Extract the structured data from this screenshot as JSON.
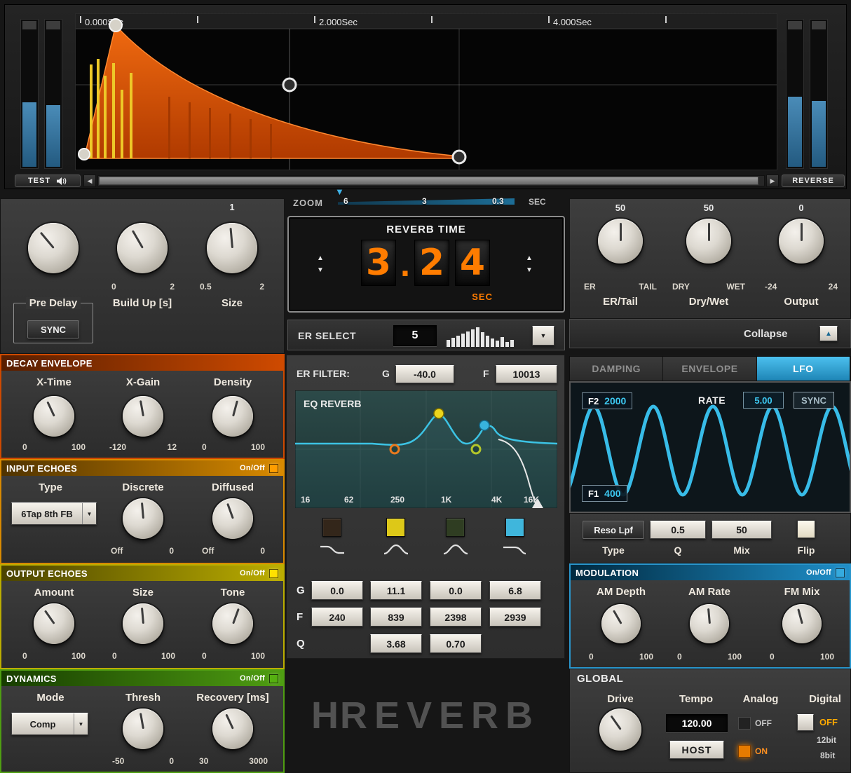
{
  "colors": {
    "envelope_orange": "#e8610a",
    "echo_yellow": "#edc928",
    "digit_orange": "#ff7c00",
    "lfo_wave_cyan": "#38bce8",
    "tab_active_blue": "#2a9fd4",
    "decay_header": "#cf4a00",
    "input_echoes_header": "#d98a00",
    "output_echoes_header": "#bcae00",
    "dynamics_header": "#4f9e12",
    "modulation_header": "#1f8fc9",
    "meter_blue": "#3a80b0"
  },
  "top": {
    "time_labels": [
      "0.000Sec",
      "2.000Sec",
      "4.000Sec"
    ],
    "test": "TEST",
    "reverse": "REVERSE"
  },
  "zoom": {
    "label": "ZOOM",
    "t1": "6",
    "t2": "3",
    "t3": "0.3",
    "unit": "SEC"
  },
  "left_top": {
    "predelay_label": "Pre Delay",
    "sync": "SYNC",
    "buildup": {
      "label": "Build Up [s]",
      "min": "0",
      "max": "2"
    },
    "size": {
      "label": "Size",
      "min": "0.5",
      "max": "2",
      "value": "1"
    }
  },
  "decay": {
    "title": "DECAY ENVELOPE",
    "knobs": [
      {
        "label": "X-Time",
        "min": "0",
        "max": "100"
      },
      {
        "label": "X-Gain",
        "min": "-120",
        "max": "12"
      },
      {
        "label": "Density",
        "min": "0",
        "max": "100"
      }
    ]
  },
  "input_echoes": {
    "title": "INPUT ECHOES",
    "onoff": "On/Off",
    "type_label": "Type",
    "type_value": "6Tap 8th FB",
    "knobs": [
      {
        "label": "Discrete",
        "min": "Off",
        "max": "0"
      },
      {
        "label": "Diffused",
        "min": "Off",
        "max": "0"
      }
    ]
  },
  "output_echoes": {
    "title": "OUTPUT ECHOES",
    "onoff": "On/Off",
    "knobs": [
      {
        "label": "Amount",
        "min": "0",
        "max": "100"
      },
      {
        "label": "Size",
        "min": "0",
        "max": "100"
      },
      {
        "label": "Tone",
        "min": "0",
        "max": "100"
      }
    ]
  },
  "dynamics": {
    "title": "DYNAMICS",
    "onoff": "On/Off",
    "mode_label": "Mode",
    "mode_value": "Comp",
    "knobs": [
      {
        "label": "Thresh",
        "min": "-50",
        "max": "0"
      },
      {
        "label": "Recovery [ms]",
        "min": "30",
        "max": "3000"
      }
    ]
  },
  "reverb_time": {
    "title": "REVERB TIME",
    "d1": "3",
    "dot": ".",
    "d2": "2",
    "d3": "4",
    "unit": "SEC"
  },
  "er_select": {
    "label": "ER SELECT",
    "value": "5"
  },
  "er_filter": {
    "label": "ER FILTER:",
    "g_label": "G",
    "g_value": "-40.0",
    "f_label": "F",
    "f_value": "10013"
  },
  "eq": {
    "title": "EQ REVERB",
    "freq_labels": [
      "16",
      "62",
      "250",
      "1K",
      "4K",
      "16K"
    ],
    "row_g": "G",
    "row_f": "F",
    "row_q": "Q",
    "g_values": [
      "0.0",
      "11.1",
      "0.0",
      "6.8"
    ],
    "f_values": [
      "240",
      "839",
      "2398",
      "2939"
    ],
    "q_values": [
      "3.68",
      "0.70"
    ]
  },
  "logo": {
    "h": "H",
    "rest": "REVERB"
  },
  "right_top": {
    "knobs": [
      {
        "value": "50",
        "min": "ER",
        "max": "TAIL",
        "label": "ER/Tail"
      },
      {
        "value": "50",
        "min": "DRY",
        "max": "WET",
        "label": "Dry/Wet"
      },
      {
        "value": "0",
        "min": "-24",
        "max": "24",
        "label": "Output"
      }
    ],
    "collapse": "Collapse"
  },
  "tabs": [
    {
      "label": "DAMPING",
      "active": false
    },
    {
      "label": "ENVELOPE",
      "active": false
    },
    {
      "label": "LFO",
      "active": true
    }
  ],
  "lfo": {
    "f2_label": "F2",
    "f2_value": "2000",
    "rate_label": "RATE",
    "rate_value": "5.00",
    "sync": "SYNC",
    "f1_label": "F1",
    "f1_value": "400",
    "type_value": "Reso Lpf",
    "q_value": "0.5",
    "mix_value": "50",
    "type_label": "Type",
    "q_label": "Q",
    "mix_label": "Mix",
    "flip_label": "Flip"
  },
  "modulation": {
    "title": "MODULATION",
    "onoff": "On/Off",
    "knobs": [
      {
        "label": "AM Depth",
        "min": "0",
        "max": "100"
      },
      {
        "label": "AM Rate",
        "min": "0",
        "max": "100"
      },
      {
        "label": "FM Mix",
        "min": "0",
        "max": "100"
      }
    ]
  },
  "global": {
    "title": "GLOBAL",
    "drive_label": "Drive",
    "tempo_label": "Tempo",
    "tempo_value": "120.00",
    "host": "HOST",
    "analog_label": "Analog",
    "analog_off": "OFF",
    "analog_on": "ON",
    "digital_label": "Digital",
    "digital_off": "OFF",
    "digital_12": "12bit",
    "digital_8": "8bit"
  }
}
